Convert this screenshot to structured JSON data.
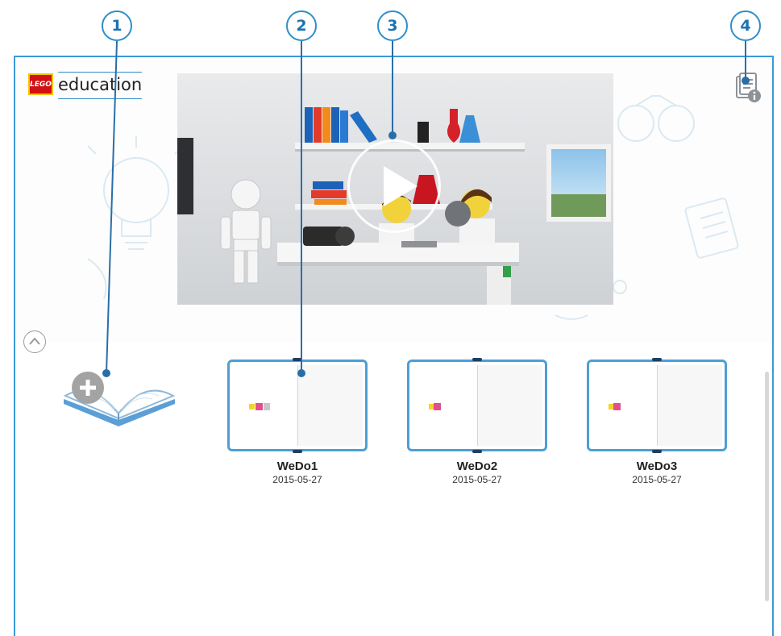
{
  "callouts": [
    "1",
    "2",
    "3",
    "4"
  ],
  "brand": {
    "badge": "LEGO",
    "name": "education",
    "accent": "#2f8fc8",
    "frame": "#3a9ad6"
  },
  "header": {
    "info_icon": "document-info-icon"
  },
  "video": {
    "play_icon": "play-icon"
  },
  "new_project": {
    "icon": "open-book-plus-icon"
  },
  "projects": [
    {
      "name": "WeDo1",
      "date": "2015-05-27"
    },
    {
      "name": "WeDo2",
      "date": "2015-05-27"
    },
    {
      "name": "WeDo3",
      "date": "2015-05-27"
    }
  ]
}
